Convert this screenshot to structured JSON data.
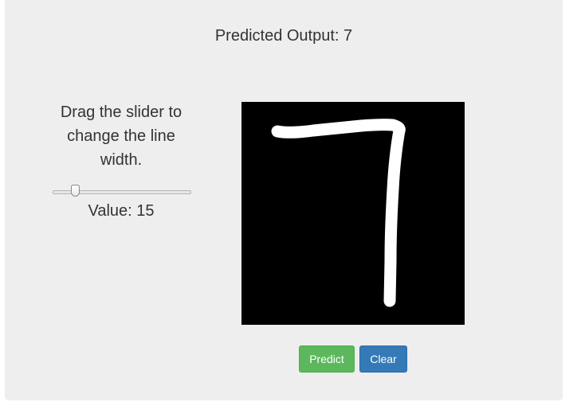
{
  "prediction": {
    "label": "Predicted Output: 7"
  },
  "slider": {
    "instructions": "Drag the slider to change the line width.",
    "value_label": "Value: 15",
    "value": 15,
    "min": 1,
    "max": 100
  },
  "canvas": {
    "background_color": "#000000",
    "stroke_color": "#ffffff"
  },
  "buttons": {
    "predict_label": "Predict",
    "predict_color": "#5cb85c",
    "clear_label": "Clear",
    "clear_color": "#337ab7"
  }
}
